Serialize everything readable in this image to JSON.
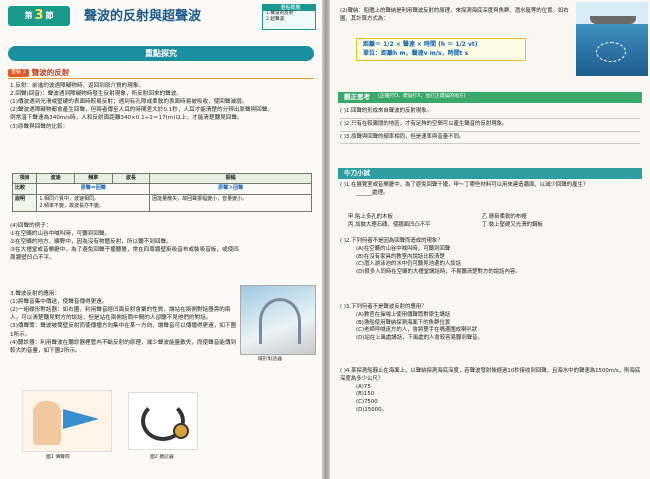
{
  "left": {
    "section_label": "第",
    "section_number": "3",
    "section_suffix": "節",
    "chapter_title": "聲波的反射與超聲波",
    "key_box": {
      "title": "重點概覽",
      "items": [
        "1.聲波的反射",
        "2.超聲波"
      ]
    },
    "banner": "重點探究",
    "subsection": {
      "tag": "重點 1",
      "title": "聲波的反射"
    },
    "lines": [
      "1.反射：前進的波遇障礙物時，返回到原介質的現象。",
      "2.回聲(回音)：聲波遇到障礙物時發生反射現象，所反射回來的聲波。",
      "(1)傳波遇到光滑或堅硬的表面時較易反射；遇到有孔隙或柔軟的表面時易被吸收，使回聲減弱。",
      "(2)聲波遇障礙物都會產生回聲，但兩者傳至人耳的時間差大於0.1秒，人耳才能清楚的分辨出原聲與回聲。",
      "例常溫下聲速為340m/s時，人和反射面距離340×0.1÷2＝17(m)以上，才能清楚聽見回聲。",
      "(3)原聲與回聲的比較："
    ],
    "table": {
      "headers": [
        "項目",
        "波速",
        "頻率",
        "波長",
        "振幅"
      ],
      "rows": [
        [
          "比較",
          "原聲＝回聲",
          "",
          "",
          "原聲＞回聲"
        ],
        [
          "說明",
          "1.相同介質中，波速相同。\n2.頻率不變，故波長亦不變。",
          "",
          "",
          "因能量散失，故回聲振幅變小，音量變小。"
        ]
      ]
    },
    "lines2": [
      "(4)回聲的例子：",
      "①在空曠的山谷中喊叫時，可聽到回聲。",
      "②在空曠的地方、曠野中，因為沒有物體反射，所以聽不到回聲。",
      "③在大禮堂或音樂廳中，為了避免回聲干擾聽覺，常在四周牆壁掛吸音布或裝吸音板，或使四周牆壁凹凸不平。"
    ],
    "lines3": [
      "3.聲波反射的應用：",
      "(1)將聲音集中傳送，使聲音傳得更遠。",
      "(2)一組碟形對話器：如右圖，利用聲音經凹面反射會聚的性質，讓站在兩側對話器旁的兩人，可以清楚聽見對方的談話，但是站在兩側話筒中間的人卻聽不見他們的對話。",
      "(3)傳聲筒：聲波被筒壁反射而使傳播方向集中在某一方向，讓聲音可以傳播得更遠，如下圖1所示。",
      "(4)聽診器：利用聲波在聽診器裡管內不斷反射的原理，減少聲波能量散失，而使聲音能傳到較大的音量，如下圖2所示。"
    ],
    "dome_caption": "碟形對話器",
    "fig1_caption": "圖1 傳聲筒",
    "fig2_caption": "圖2 聽診器"
  },
  "right": {
    "intro": "(2)聲納：船艦上的聲納是利用聲波反射的原理，來探測海底深度與魚群、潛水艇等的位置。如右圖，其計算方式為：",
    "formula_line1": "距離＝ 1/2 × 聲速 × 時間 (h ＝ 1/2 vt)",
    "formula_line2": "單位：距離h m，聲速v m/s，時間t s",
    "quiz1": {
      "title": "觀正思考",
      "subtitle": "(正確打O，錯誤打X，並訂正錯誤的地方)",
      "items": [
        "(   )1.回聲的形成來自聲波的反射現象。",
        "(   )2.只有在較廣闊的地區，才有足夠的空間可以產生聲音的反射現象。",
        "(   )3.原聲與回聲的頻率相同，但是速率與音量不同。"
      ]
    },
    "quiz2": {
      "title": "牛刀小試",
      "stem": "( )1.在展覽室或音樂廳中，為了避免回聲干擾，甲～丁哪些材料可以用來建造牆面，以減少回聲的產生？",
      "blank_label": "______處理。",
      "options": [
        "甲.貼上多孔的木板",
        "乙.懸掛柔軟的布幔",
        "丙.加裝大理石磚，使牆面凹凸不平",
        "丁.裝上堅硬又光滑的鋼板"
      ],
      "q2": "( )2.下列何者不是因為回聲而造成的現象？",
      "q2_opts": [
        "(A)在空曠的山谷中喊叫時，可聽到回聲",
        "(B)在沒有家具的教室內說話比較清楚",
        "(C)潛入游泳池的水中仍可聽見池邊的人談話",
        "(D)很多人同時在空曠的大禮堂講話時，不易聽清楚對方的說話內容。"
      ],
      "q3": "( )3.下列何者不是聲波反射的應用？",
      "q3_opts": [
        "(A)教官在操場上使用傳聲筒對學生講話",
        "(B)漁船使用聲納探測海面下的魚群位置",
        "(C)老師呼喊遠方的人，會將雙手在嘴邊圍成喇叭狀",
        "(D)站在上風處講話，下風處的人會較容易聽到聲音。"
      ],
      "q4": "( )4.某探測船靜止在海面上，以聲納探測海底深度，若聲波發射後經過10秒接收到回聲，且海水中的聲速為1500m/s，則海底深度為多少公尺？",
      "q4_opts": [
        "(A)75",
        "(B)150",
        "(C)7500",
        "(D)15000。"
      ]
    }
  }
}
